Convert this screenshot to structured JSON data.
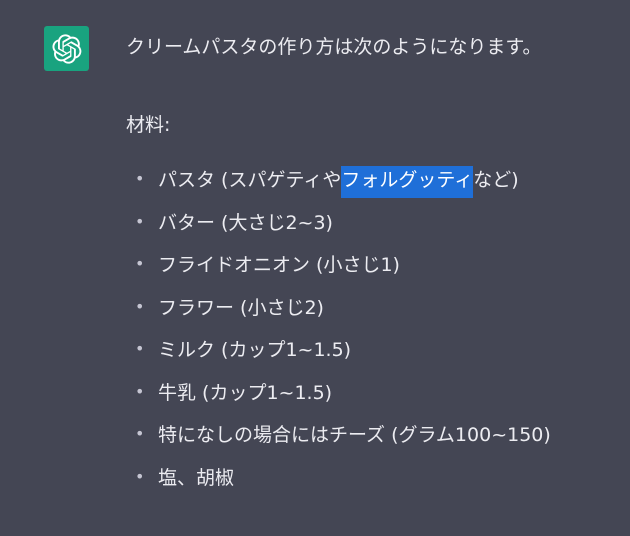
{
  "assistant": {
    "icon": "openai-logo-icon",
    "color": "#19a37f"
  },
  "message": {
    "intro": "クリームパスタの作り方は次のようになります。",
    "section_title": "材料:",
    "items": [
      {
        "before": "パスタ (スパゲティや",
        "highlight": "フォルグッティ",
        "after": "など)"
      },
      {
        "text": "バター (大さじ2~3)"
      },
      {
        "text": "フライドオニオン (小さじ1)"
      },
      {
        "text": "フラワー (小さじ2)"
      },
      {
        "text": "ミルク (カップ1~1.5)"
      },
      {
        "text": "牛乳 (カップ1~1.5)"
      },
      {
        "text": "特になしの場合にはチーズ (グラム100~150)"
      },
      {
        "text": "塩、胡椒"
      }
    ]
  },
  "colors": {
    "background": "#444654",
    "text": "#ececf1",
    "selection": "#1f6fd8"
  }
}
